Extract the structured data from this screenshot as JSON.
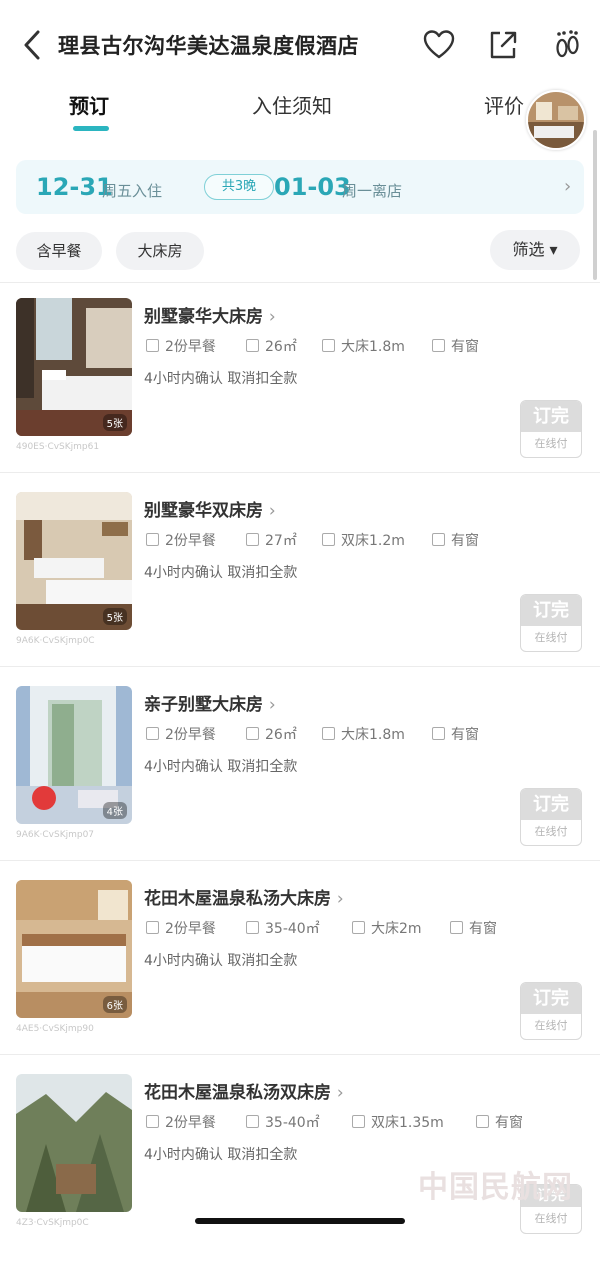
{
  "header": {
    "title": "理县古尔沟华美达温泉度假酒店",
    "icons": [
      "back-icon",
      "heart-icon",
      "share-icon",
      "footprint-icon"
    ]
  },
  "tabs": [
    {
      "label": "预订",
      "active": true
    },
    {
      "label": "入住须知",
      "active": false
    },
    {
      "label": "评价",
      "active": false
    }
  ],
  "dates": {
    "checkin": "12-31",
    "checkin_label": "周五入住",
    "nights": "共3晚",
    "checkout": "01-03",
    "checkout_label": "周一离店",
    "arrow": "›"
  },
  "filters": {
    "chips": [
      "含早餐",
      "大床房"
    ],
    "filter_label": "筛选 ▾"
  },
  "rooms": [
    {
      "name": "别墅豪华大床房",
      "breakfast": "2份早餐",
      "area": "26㎡",
      "bed": "大床1.8m",
      "window": "有窗",
      "policy": "4小时内确认   取消扣全款",
      "photos": "5张",
      "caption": "490ES·CvSKjmp61",
      "status": "订完",
      "pay": "在线付"
    },
    {
      "name": "别墅豪华双床房",
      "breakfast": "2份早餐",
      "area": "27㎡",
      "bed": "双床1.2m",
      "window": "有窗",
      "policy": "4小时内确认   取消扣全款",
      "photos": "5张",
      "caption": "9A6K·CvSKjmp0C",
      "status": "订完",
      "pay": "在线付"
    },
    {
      "name": "亲子别墅大床房",
      "breakfast": "2份早餐",
      "area": "26㎡",
      "bed": "大床1.8m",
      "window": "有窗",
      "policy": "4小时内确认   取消扣全款",
      "photos": "4张",
      "caption": "9A6K·CvSKjmp07",
      "status": "订完",
      "pay": "在线付"
    },
    {
      "name": "花田木屋温泉私汤大床房",
      "breakfast": "2份早餐",
      "area": "35-40㎡",
      "bed": "大床2m",
      "window": "有窗",
      "policy": "4小时内确认   取消扣全款",
      "photos": "6张",
      "caption": "4AE5·CvSKjmp90",
      "status": "订完",
      "pay": "在线付"
    },
    {
      "name": "花田木屋温泉私汤双床房",
      "breakfast": "2份早餐",
      "area": "35-40㎡",
      "bed": "双床1.35m",
      "window": "有窗",
      "policy": "4小时内确认   取消扣全款",
      "photos": "",
      "caption": "4Z3·CvSKjmp0C",
      "status": "订完",
      "pay": "在线付"
    }
  ],
  "watermark": "中国民航网",
  "colors": {
    "accent": "#2bb5c0",
    "date": "#2aa7b6",
    "sold": "#dcdcdc"
  }
}
